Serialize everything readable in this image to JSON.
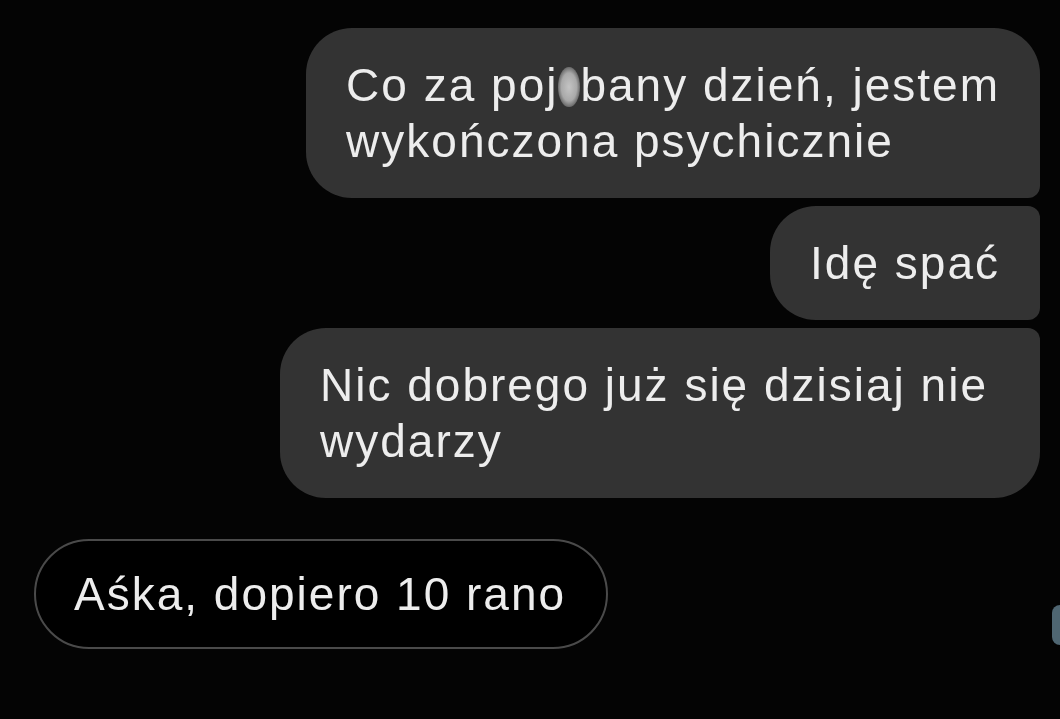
{
  "messages": [
    {
      "kind": "sent",
      "parts": [
        {
          "kind": "text",
          "text": "Co za poj"
        },
        {
          "kind": "censor"
        },
        {
          "kind": "text",
          "text": "bany dzień, jestem"
        },
        {
          "kind": "break"
        },
        {
          "kind": "text",
          "text": "wykończona psychicznie"
        }
      ]
    },
    {
      "kind": "sent",
      "parts": [
        {
          "kind": "text",
          "text": "Idę spać"
        }
      ]
    },
    {
      "kind": "sent",
      "parts": [
        {
          "kind": "text",
          "text": "Nic dobrego już się dzisiaj nie wydarzy"
        }
      ]
    },
    {
      "kind": "received",
      "parts": [
        {
          "kind": "text",
          "text": "Aśka, dopiero 10 rano"
        }
      ]
    }
  ]
}
